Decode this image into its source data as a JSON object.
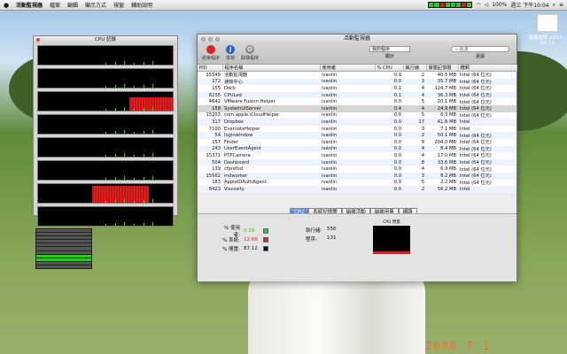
{
  "menubar": {
    "app_name": "活動監視器",
    "items": [
      "檔案",
      "編輯",
      "顯示方式",
      "視窗",
      "輔助說明"
    ],
    "battery": "100%",
    "clock": "週三 下午10:04",
    "spotlight_icon": "search-icon"
  },
  "desktop_icon": {
    "label": "螢幕快照 2012…04.11"
  },
  "datestamp": "2008 7 1",
  "cpu_history": {
    "title": "CPU 記錄",
    "core_levels": [
      0.05,
      0.04,
      0.7,
      0.04,
      0.05,
      0.04,
      0.9,
      0.04
    ]
  },
  "main_window": {
    "title": "活動監視器",
    "toolbar": {
      "quit_label": "結束程序",
      "inspect_label": "檢視",
      "sample_label": "取樣程序",
      "filter_value": "我的程序",
      "filter_caption": "顯示",
      "search_placeholder": "過濾",
      "search_caption": "過濾"
    },
    "columns": [
      "PID",
      "程序名稱",
      "使用者",
      "% CPU",
      "執行緒",
      "實體記憶體",
      "種類"
    ],
    "rows": [
      {
        "pid": "15549",
        "name": "活動監視器",
        "user": "ivanlin",
        "cpu": "0.9",
        "threads": "2",
        "mem": "40.5 MB",
        "kind": "Intel (64 位元)"
      },
      {
        "pid": "172",
        "name": "通知中心",
        "user": "ivanlin",
        "cpu": "0.0",
        "threads": "3",
        "mem": "35.7 MB",
        "kind": "Intel (64 位元)"
      },
      {
        "pid": "155",
        "name": "Dock",
        "user": "ivanlin",
        "cpu": "0.1",
        "threads": "4",
        "mem": "124.7 MB",
        "kind": "Intel (64 位元)"
      },
      {
        "pid": "8235",
        "name": "CPULed",
        "user": "ivanlin",
        "cpu": "0.1",
        "threads": "4",
        "mem": "36.3 MB",
        "kind": "Intel (64 位元)"
      },
      {
        "pid": "4642",
        "name": "VMware Fusion Helper",
        "user": "ivanlin",
        "cpu": "0.0",
        "threads": "5",
        "mem": "20.1 MB",
        "kind": "Intel (64 位元)"
      },
      {
        "pid": "158",
        "name": "SystemUIServer",
        "user": "ivanlin",
        "cpu": "0.4",
        "threads": "4",
        "mem": "24.9 MB",
        "kind": "Intel (64 位元)"
      },
      {
        "pid": "15203",
        "name": "com.apple.iCloudHelper",
        "user": "ivanlin",
        "cpu": "0.0",
        "threads": "5",
        "mem": "6.3 MB",
        "kind": "Intel (64 位元)"
      },
      {
        "pid": "317",
        "name": "Dropbox",
        "user": "ivanlin",
        "cpu": "0.0",
        "threads": "17",
        "mem": "41.8 MB",
        "kind": "Intel"
      },
      {
        "pid": "7100",
        "name": "EvernoteHelper",
        "user": "ivanlin",
        "cpu": "0.0",
        "threads": "3",
        "mem": "7.1 MB",
        "kind": "Intel"
      },
      {
        "pid": "54",
        "name": "loginwindow",
        "user": "ivanlin",
        "cpu": "0.0",
        "threads": "2",
        "mem": "50.1 MB",
        "kind": "Intel (64 位元)"
      },
      {
        "pid": "157",
        "name": "Finder",
        "user": "ivanlin",
        "cpu": "0.0",
        "threads": "9",
        "mem": "204.0 MB",
        "kind": "Intel (64 位元)"
      },
      {
        "pid": "243",
        "name": "UserEventAgent",
        "user": "ivanlin",
        "cpu": "0.0",
        "threads": "4",
        "mem": "8.4 MB",
        "kind": "Intel (64 位元)"
      },
      {
        "pid": "15371",
        "name": "PTPCamera",
        "user": "ivanlin",
        "cpu": "0.0",
        "threads": "4",
        "mem": "17.0 MB",
        "kind": "Intel (64 位元)"
      },
      {
        "pid": "504",
        "name": "Dashboard",
        "user": "ivanlin",
        "cpu": "0.0",
        "threads": "8",
        "mem": "33.6 MB",
        "kind": "Intel (64 位元)"
      },
      {
        "pid": "139",
        "name": "cfprefsd",
        "user": "ivanlin",
        "cpu": "0.0",
        "threads": "4",
        "mem": "6.9 MB",
        "kind": "Intel (64 位元)"
      },
      {
        "pid": "15562",
        "name": "mdworker",
        "user": "ivanlin",
        "cpu": "0.0",
        "threads": "3",
        "mem": "8.2 MB",
        "kind": "Intel (64 位元)"
      },
      {
        "pid": "183",
        "name": "AppleIDAuthAgent",
        "user": "ivanlin",
        "cpu": "0.0",
        "threads": "5",
        "mem": "2.2 MB",
        "kind": "Intel (64 位元)"
      },
      {
        "pid": "8423",
        "name": "Viscosity",
        "user": "ivanlin",
        "cpu": "0.0",
        "threads": "2",
        "mem": "56.2 MB",
        "kind": "Intel"
      }
    ],
    "selected_row": 5,
    "tabs": [
      "CPU",
      "系統記憶體",
      "磁碟活動",
      "磁碟用量",
      "網路"
    ],
    "active_tab": 0,
    "cpu_panel": {
      "user_label": "% 使用者:",
      "user_value": "0.19",
      "user_color": "#2fbf2f",
      "system_label": "% 系統:",
      "system_value": "12.69",
      "system_color": "#e02020",
      "idle_label": "% 閒置:",
      "idle_value": "87.12",
      "idle_color": "#111111",
      "threads_label": "執行緒:",
      "threads_value": "556",
      "processes_label": "程序:",
      "processes_value": "131",
      "graph_title": "CPU 用量"
    }
  }
}
